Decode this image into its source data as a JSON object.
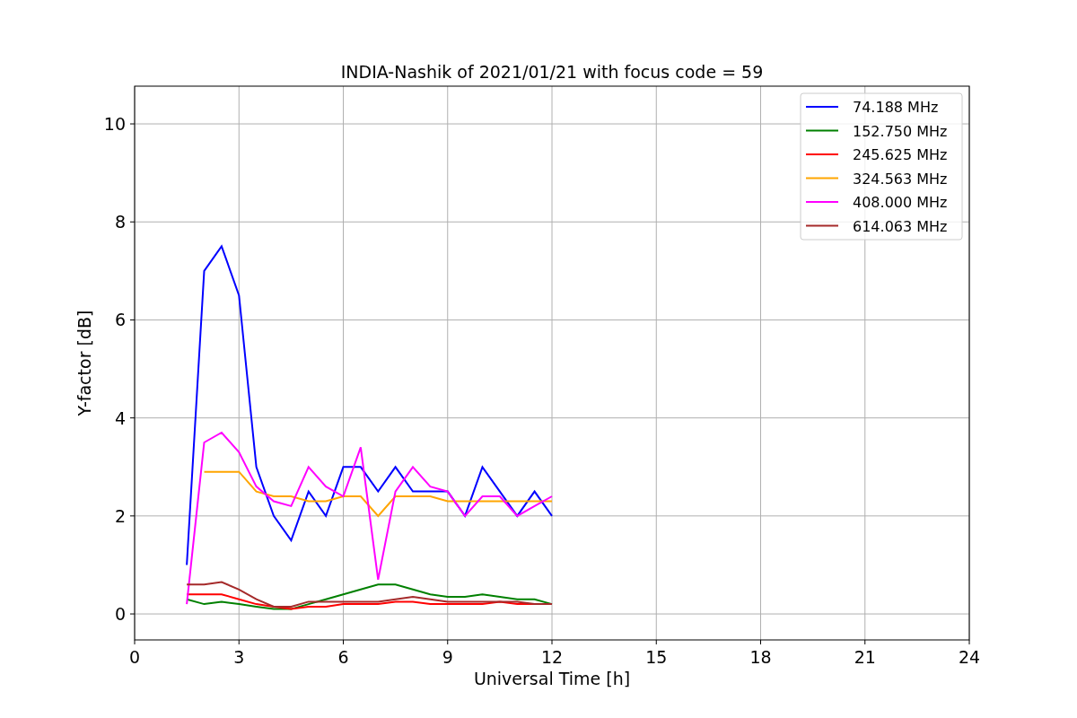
{
  "figure": {
    "chart_data": {
      "type": "line",
      "title": "INDIA-Nashik of 2021/01/21 with focus code = 59",
      "xlabel": "Universal Time [h]",
      "ylabel": "Y-factor [dB]",
      "x": [
        1.5,
        2,
        2.5,
        3,
        3.5,
        4,
        4.5,
        5,
        5.5,
        6,
        6.5,
        7,
        7.5,
        8,
        8.5,
        9,
        9.5,
        10,
        10.5,
        11,
        11.5,
        12
      ],
      "series": [
        {
          "name": "74.188 MHz",
          "color": "#0000ff",
          "values": [
            1.0,
            7.0,
            7.5,
            6.5,
            3.0,
            2.0,
            1.5,
            2.5,
            2.0,
            3.0,
            3.0,
            2.5,
            3.0,
            2.5,
            2.5,
            2.5,
            2.0,
            3.0,
            2.5,
            2.0,
            2.5,
            2.0
          ]
        },
        {
          "name": "152.750 MHz",
          "color": "#008000",
          "values": [
            0.3,
            0.2,
            0.25,
            0.2,
            0.15,
            0.1,
            0.1,
            0.2,
            0.3,
            0.4,
            0.5,
            0.6,
            0.6,
            0.5,
            0.4,
            0.35,
            0.35,
            0.4,
            0.35,
            0.3,
            0.3,
            0.2
          ]
        },
        {
          "name": "245.625 MHz",
          "color": "#ff0000",
          "values": [
            0.4,
            0.4,
            0.4,
            0.3,
            0.2,
            0.15,
            0.1,
            0.15,
            0.15,
            0.2,
            0.2,
            0.2,
            0.25,
            0.25,
            0.2,
            0.2,
            0.2,
            0.2,
            0.25,
            0.2,
            0.2,
            0.2
          ]
        },
        {
          "name": "324.563 MHz",
          "color": "#ffa500",
          "values": [
            null,
            2.9,
            2.9,
            2.9,
            2.5,
            2.4,
            2.4,
            2.3,
            2.3,
            2.4,
            2.4,
            2.0,
            2.4,
            2.4,
            2.4,
            2.3,
            2.3,
            2.3,
            2.3,
            2.3,
            2.3,
            2.3
          ]
        },
        {
          "name": "408.000 MHz",
          "color": "#ff00ff",
          "values": [
            0.2,
            3.5,
            3.7,
            3.3,
            2.6,
            2.3,
            2.2,
            3.0,
            2.6,
            2.4,
            3.4,
            0.7,
            2.5,
            3.0,
            2.6,
            2.5,
            2.0,
            2.4,
            2.4,
            2.0,
            2.2,
            2.4
          ]
        },
        {
          "name": "614.063 MHz",
          "color": "#a52a2a",
          "values": [
            0.6,
            0.6,
            0.65,
            0.5,
            0.3,
            0.15,
            0.15,
            0.25,
            0.25,
            0.25,
            0.25,
            0.25,
            0.3,
            0.35,
            0.3,
            0.25,
            0.25,
            0.25,
            0.25,
            0.25,
            0.2,
            0.2
          ]
        }
      ],
      "xlim": [
        0,
        24
      ],
      "ylim": [
        -0.53,
        10.77
      ],
      "xticks": [
        0,
        3,
        6,
        9,
        12,
        15,
        18,
        21,
        24
      ],
      "yticks": [
        0,
        2,
        4,
        6,
        8,
        10
      ],
      "grid": true,
      "legend": true
    }
  }
}
